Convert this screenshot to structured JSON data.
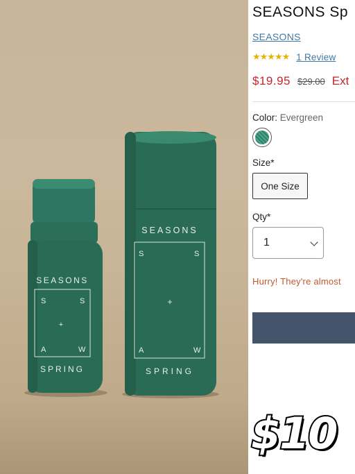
{
  "product": {
    "title": "SEASONS Sp",
    "brand": "SEASONS",
    "rating_stars": "★★★★★",
    "review_link": "1 Review",
    "sale_price": "$19.95",
    "original_price": "$29.00",
    "promo_text": "Ext",
    "color_label": "Color:",
    "color_value": "Evergreen",
    "size_label": "Size*",
    "size_option": "One Size",
    "qty_label": "Qty*",
    "qty_value": "1",
    "stock_message": "Hurry! They're almost"
  },
  "photo": {
    "dropper_bottle": {
      "brand_text": "SEASONS",
      "letters": [
        "S",
        "S",
        "A",
        "W"
      ],
      "plus": "+",
      "scent_text": "SPRING"
    },
    "tube": {
      "brand_text": "SEASONS",
      "letters": [
        "S",
        "S",
        "A",
        "W"
      ],
      "plus": "+",
      "scent_text": "SPRING"
    },
    "product_color": "#2a6b55"
  },
  "overlay": {
    "price_sticker": "$10"
  },
  "colors": {
    "sale_price": "#c2262b",
    "link": "#3f79a8",
    "stars": "#e9b400",
    "cta": "#44546a"
  }
}
